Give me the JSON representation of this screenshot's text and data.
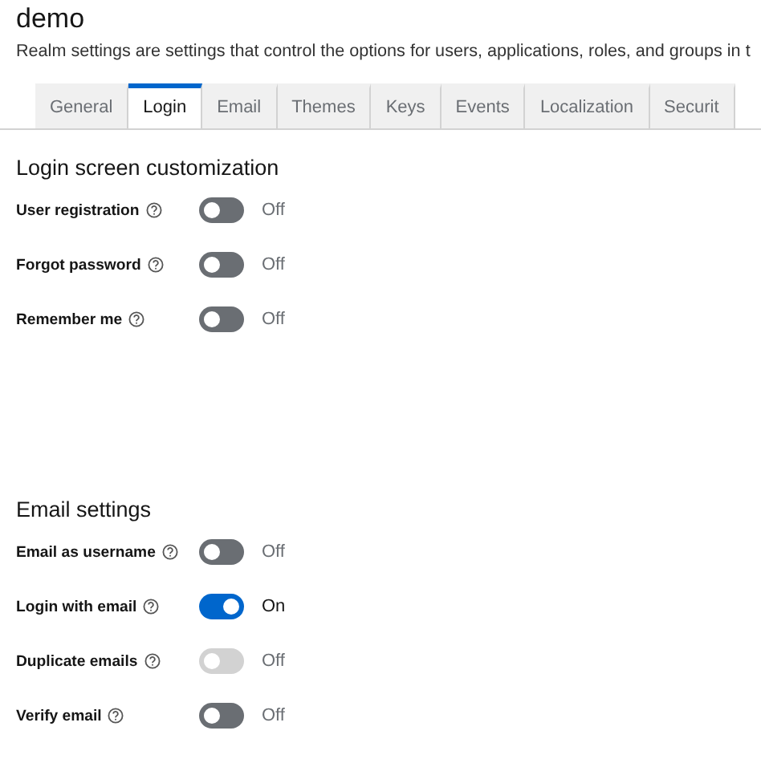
{
  "realm": {
    "title": "demo",
    "description": "Realm settings are settings that control the options for users, applications, roles, and groups in t"
  },
  "tabs": [
    {
      "label": "General",
      "selected": false
    },
    {
      "label": "Login",
      "selected": true
    },
    {
      "label": "Email",
      "selected": false
    },
    {
      "label": "Themes",
      "selected": false
    },
    {
      "label": "Keys",
      "selected": false
    },
    {
      "label": "Events",
      "selected": false
    },
    {
      "label": "Localization",
      "selected": false
    },
    {
      "label": "Securit",
      "selected": false
    }
  ],
  "sections": [
    {
      "heading": "Login screen customization",
      "settings": [
        {
          "label": "User registration",
          "on": false,
          "disabled": false,
          "status": "Off"
        },
        {
          "label": "Forgot password",
          "on": false,
          "disabled": false,
          "status": "Off"
        },
        {
          "label": "Remember me",
          "on": false,
          "disabled": false,
          "status": "Off"
        }
      ]
    },
    {
      "heading": "Email settings",
      "settings": [
        {
          "label": "Email as username",
          "on": false,
          "disabled": false,
          "status": "Off"
        },
        {
          "label": "Login with email",
          "on": true,
          "disabled": false,
          "status": "On"
        },
        {
          "label": "Duplicate emails",
          "on": false,
          "disabled": true,
          "status": "Off"
        },
        {
          "label": "Verify email",
          "on": false,
          "disabled": false,
          "status": "Off"
        }
      ]
    }
  ]
}
